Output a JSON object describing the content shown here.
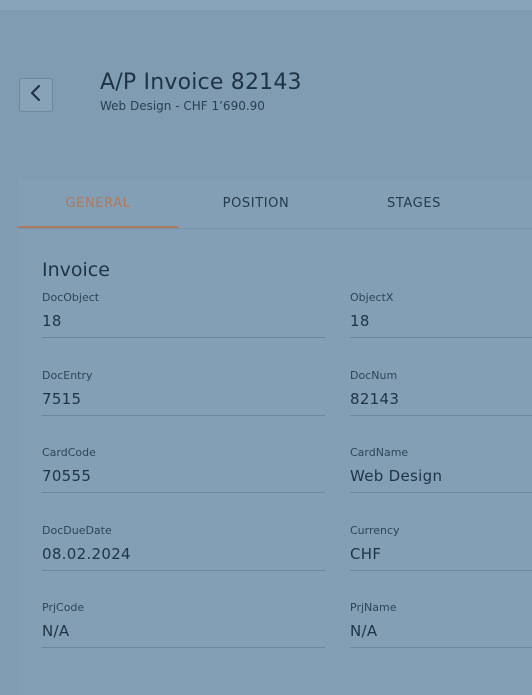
{
  "header": {
    "title": "A/P Invoice 82143",
    "subtitle": "Web Design - CHF 1’690.90"
  },
  "tabs": [
    {
      "label": "GENERAL",
      "active": true
    },
    {
      "label": "POSITION",
      "active": false
    },
    {
      "label": "STAGES",
      "active": false
    }
  ],
  "section": {
    "title": "Invoice"
  },
  "fields": {
    "docobject": {
      "label": "DocObject",
      "value": "18"
    },
    "objectx": {
      "label": "ObjectX",
      "value": "18"
    },
    "docentry": {
      "label": "DocEntry",
      "value": "7515"
    },
    "docnum": {
      "label": "DocNum",
      "value": "82143"
    },
    "cardcode": {
      "label": "CardCode",
      "value": "70555"
    },
    "cardname": {
      "label": "CardName",
      "value": "Web Design"
    },
    "docduedate": {
      "label": "DocDueDate",
      "value": "08.02.2024"
    },
    "currency": {
      "label": "Currency",
      "value": "CHF"
    },
    "prjcode": {
      "label": "PrjCode",
      "value": "N/A"
    },
    "prjname": {
      "label": "PrjName",
      "value": "N/A"
    }
  },
  "colors": {
    "accent": "#b0795c",
    "background": "#7f9cb3",
    "text": "#1f3344"
  },
  "icons": {
    "back": "chevron-left-icon"
  }
}
